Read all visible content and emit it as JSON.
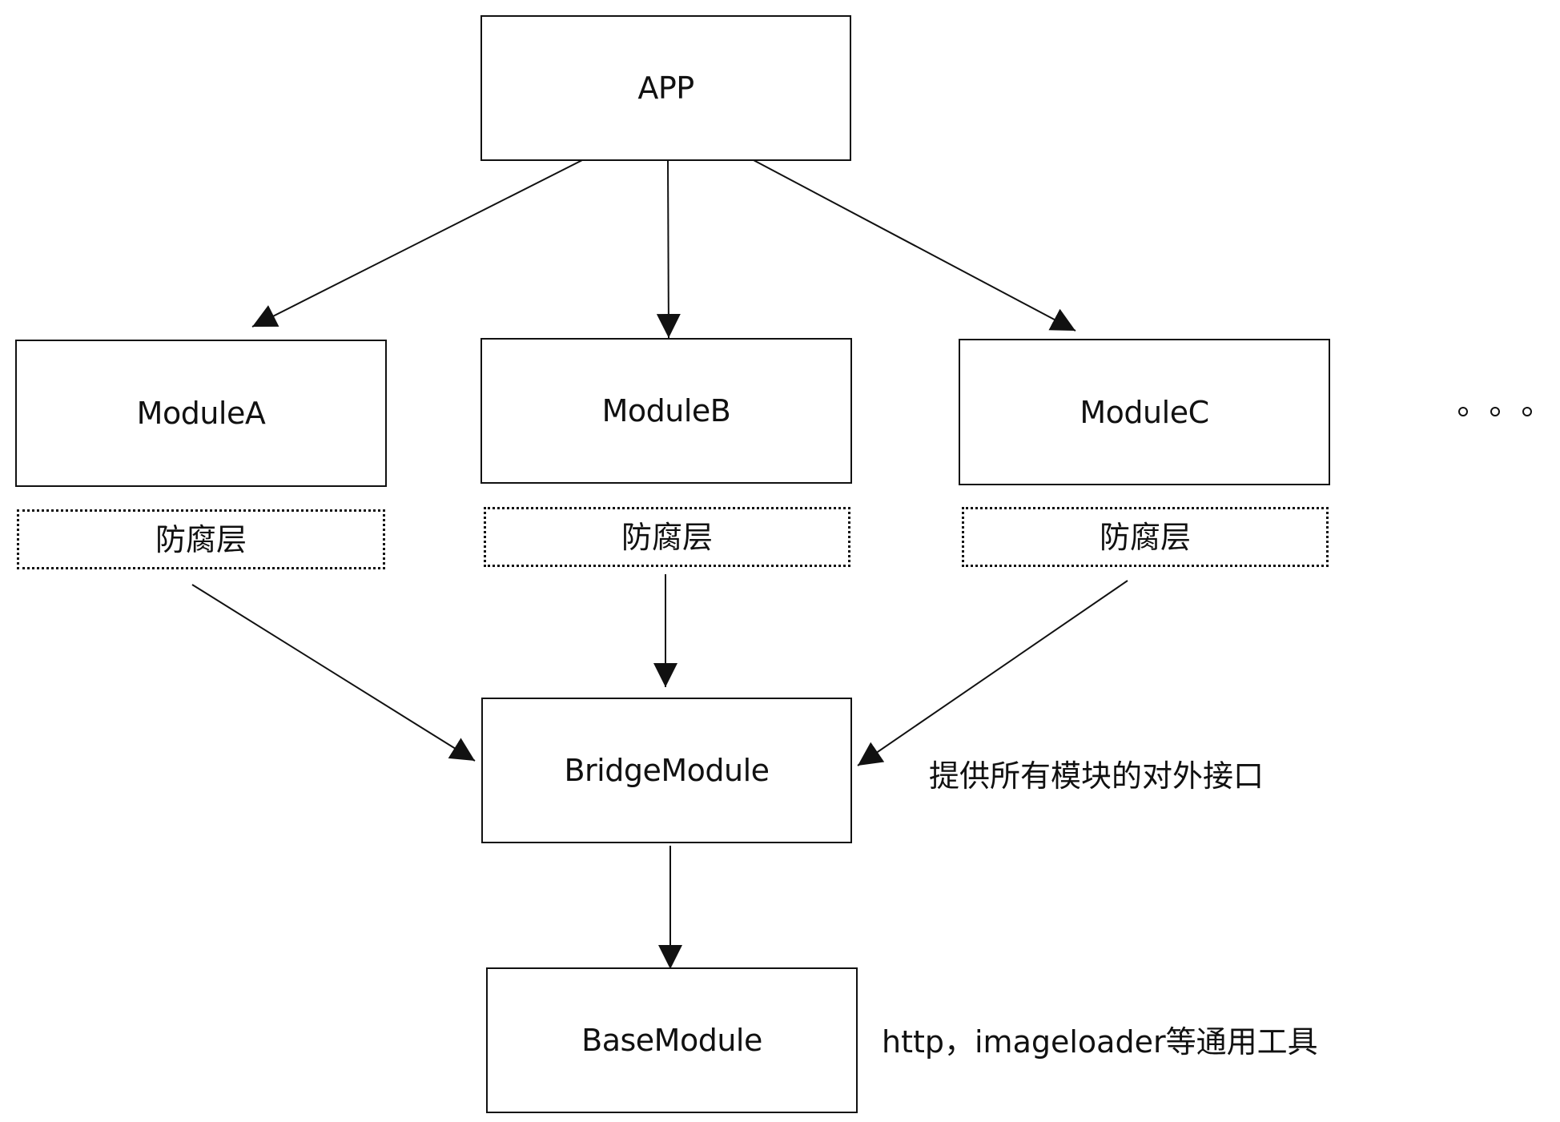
{
  "nodes": {
    "app": "APP",
    "module_a": "ModuleA",
    "module_b": "ModuleB",
    "module_c": "ModuleC",
    "bridge": "BridgeModule",
    "base": "BaseModule"
  },
  "acl_layers": {
    "a": "防腐层",
    "b": "防腐层",
    "c": "防腐层"
  },
  "notes": {
    "bridge": "提供所有模块的对外接口",
    "base": "http，imageloader等通用工具"
  },
  "ellipsis_icon": "circle-dots-ellipsis-icon",
  "colors": {
    "stroke": "#111111",
    "background": "#ffffff"
  }
}
